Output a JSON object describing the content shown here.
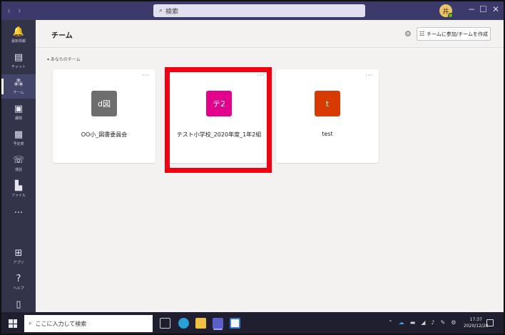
{
  "titlebar": {
    "search_placeholder": "検索",
    "avatar_initial": "井",
    "window_controls": [
      "−",
      "☐",
      "✕"
    ]
  },
  "rail": {
    "items": [
      {
        "label": "最新情報",
        "icon": "bell-icon",
        "glyph": "🔔"
      },
      {
        "label": "チャット",
        "icon": "chat-icon",
        "glyph": "▤"
      },
      {
        "label": "チーム",
        "icon": "teams-icon",
        "glyph": "⁂",
        "active": true
      },
      {
        "label": "課題",
        "icon": "assignments-icon",
        "glyph": "▣"
      },
      {
        "label": "予定表",
        "icon": "calendar-icon",
        "glyph": "▦"
      },
      {
        "label": "通話",
        "icon": "phone-icon",
        "glyph": "☏"
      },
      {
        "label": "ファイル",
        "icon": "files-icon",
        "glyph": "▙"
      },
      {
        "label": "",
        "icon": "more-icon",
        "glyph": "···"
      }
    ],
    "bottom_items": [
      {
        "label": "アプリ",
        "icon": "apps-icon",
        "glyph": "⊞"
      },
      {
        "label": "ヘルプ",
        "icon": "help-icon",
        "glyph": "?"
      },
      {
        "label": "",
        "icon": "device-icon",
        "glyph": "▯"
      }
    ]
  },
  "header": {
    "title": "チーム",
    "join_button": "チームに参加/チームを作成"
  },
  "section_label": "▾ あなたのチーム",
  "teams": [
    {
      "name": "OO小_図書委員会",
      "tile": "d図",
      "color": "#6e6e6e"
    },
    {
      "name": "テスト小学校_2020年度_1年2組",
      "tile": "テ2",
      "color": "#e3008c"
    },
    {
      "name": "test",
      "tile": "t",
      "color": "#d83b01"
    }
  ],
  "taskbar": {
    "search_placeholder": "ここに入力して検索",
    "time": "17:37",
    "date": "2020/12/28"
  }
}
